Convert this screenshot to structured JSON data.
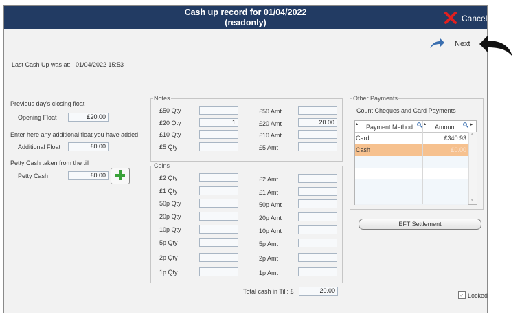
{
  "window": {
    "title_line1": "Cash up record for 01/04/2022",
    "title_line2": "(readonly)",
    "cancel_label": "Cancel",
    "next_label": "Next"
  },
  "last_cash_up": {
    "label": "Last Cash Up was at:",
    "value": "01/04/2022 15:53"
  },
  "float": {
    "prev_heading": "Previous day's closing float",
    "opening_label": "Opening Float",
    "opening_value": "£20.00",
    "additional_heading": "Enter here any additional float you have added",
    "additional_label": "Additional Float",
    "additional_value": "£0.00",
    "petty_heading": "Petty Cash taken from the till",
    "petty_label": "Petty Cash",
    "petty_value": "£0.00"
  },
  "notes": {
    "title": "Notes",
    "rows": [
      {
        "qty_label": "£50 Qty",
        "qty": "",
        "amt_label": "£50 Amt",
        "amt": ""
      },
      {
        "qty_label": "£20 Qty",
        "qty": "1",
        "amt_label": "£20 Amt",
        "amt": "20.00"
      },
      {
        "qty_label": "£10 Qty",
        "qty": "",
        "amt_label": "£10 Amt",
        "amt": ""
      },
      {
        "qty_label": "£5 Qty",
        "qty": "",
        "amt_label": "£5 Amt",
        "amt": ""
      }
    ]
  },
  "coins": {
    "title": "Coins",
    "rows": [
      {
        "qty_label": "£2 Qty",
        "qty": "",
        "amt_label": "£2 Amt",
        "amt": ""
      },
      {
        "qty_label": "£1 Qty",
        "qty": "",
        "amt_label": "£1 Amt",
        "amt": ""
      },
      {
        "qty_label": "50p Qty",
        "qty": "",
        "amt_label": "50p Amt",
        "amt": ""
      },
      {
        "qty_label": "20p Qty",
        "qty": "",
        "amt_label": "20p Amt",
        "amt": ""
      },
      {
        "qty_label": "10p Qty",
        "qty": "",
        "amt_label": "10p Amt",
        "amt": ""
      },
      {
        "qty_label": "5p Qty",
        "qty": "",
        "amt_label": "5p Amt",
        "amt": ""
      },
      {
        "qty_label": "2p Qty",
        "qty": "",
        "amt_label": "2p Amt",
        "amt": ""
      },
      {
        "qty_label": "1p Qty",
        "qty": "",
        "amt_label": "1p Amt",
        "amt": ""
      }
    ]
  },
  "total": {
    "label": "Total cash in Till: £",
    "value": "20.00"
  },
  "other_payments": {
    "title": "Other Payments",
    "subtitle": "Count Cheques and Card Payments",
    "col_method": "Payment Method",
    "col_amount": "Amount",
    "rows": [
      {
        "method": "Card",
        "amount": "£340.93"
      },
      {
        "method": "Cash",
        "amount": "£0.00"
      }
    ],
    "eft_label": "EFT Settlement"
  },
  "locked": {
    "label": "Locked",
    "checked": true
  },
  "colors": {
    "titlebar": "#223b63",
    "selected_row": "#f6c18f",
    "cancel_x": "#e02020",
    "next_arrow": "#3a6fb0",
    "plus": "#3aa23a"
  }
}
